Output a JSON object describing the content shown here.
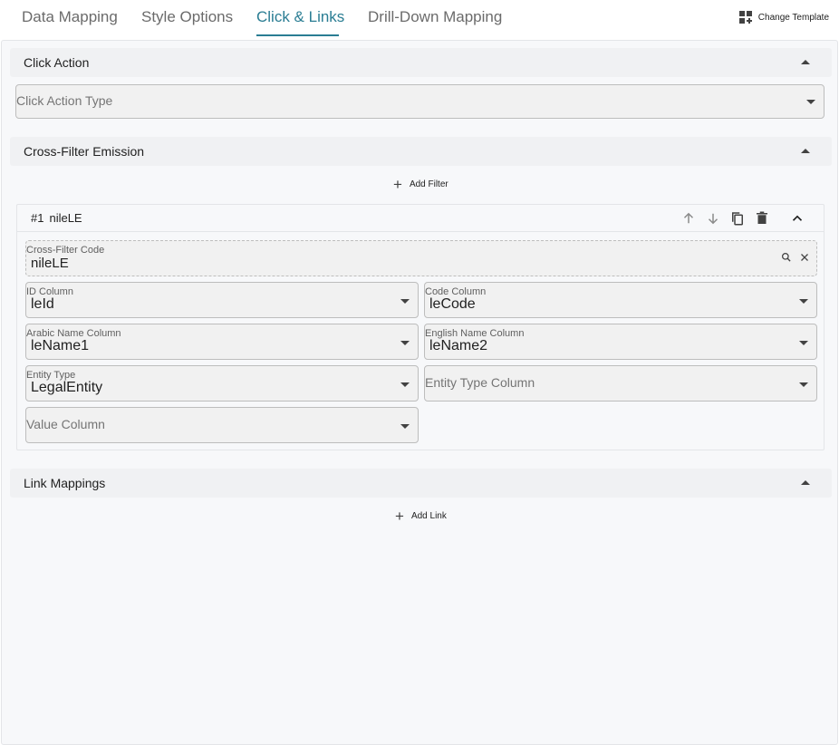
{
  "tabs": [
    {
      "label": "Data Mapping",
      "active": false
    },
    {
      "label": "Style Options",
      "active": false
    },
    {
      "label": "Click & Links",
      "active": true
    },
    {
      "label": "Drill-Down Mapping",
      "active": false
    }
  ],
  "toolbar": {
    "change_template_label": "Change Template"
  },
  "click_action": {
    "title": "Click Action",
    "type_placeholder": "Click Action Type"
  },
  "cross_filter": {
    "title": "Cross-Filter Emission",
    "add_filter_label": "Add Filter",
    "filters": [
      {
        "number": "#1",
        "name": "nileLE",
        "code": {
          "label": "Cross-Filter Code",
          "value": "nileLE"
        },
        "id_column": {
          "label": "ID Column",
          "value": "leId"
        },
        "code_column": {
          "label": "Code Column",
          "value": "leCode"
        },
        "arabic_name_column": {
          "label": "Arabic Name Column",
          "value": "leName1"
        },
        "english_name_column": {
          "label": "English Name Column",
          "value": "leName2"
        },
        "entity_type": {
          "label": "Entity Type",
          "value": "LegalEntity"
        },
        "entity_type_column": {
          "placeholder": "Entity Type Column"
        },
        "value_column": {
          "placeholder": "Value Column"
        }
      }
    ]
  },
  "link_mappings": {
    "title": "Link Mappings",
    "add_link_label": "Add Link"
  },
  "colors": {
    "accent": "#2a7d93",
    "panel_bg": "#f7f8fa",
    "header_bg": "#f0f1f3"
  }
}
